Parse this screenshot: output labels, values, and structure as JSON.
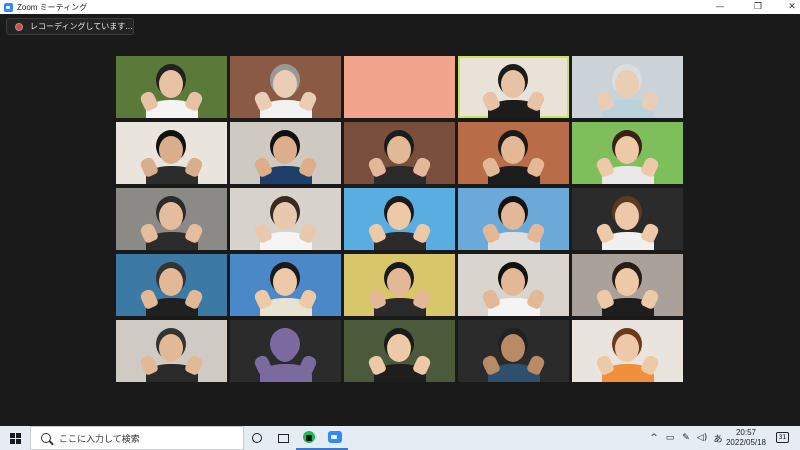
{
  "window": {
    "title": "Zoom ミーティング",
    "minimize": "—",
    "maximize": "❐",
    "close": "✕"
  },
  "recording": {
    "label": "レコーディングしています..."
  },
  "gallery": {
    "active_speaker_index": 3,
    "tiles": [
      {
        "bg": "#5b7a3a",
        "shirt": "#f4f4f4",
        "skin": "#e7c2a4",
        "hair": "#222"
      },
      {
        "bg": "#8a5a44",
        "shirt": "#f2f2f2",
        "skin": "#e9cdb4",
        "hair": "#999"
      },
      {
        "bg": "#f2a48c",
        "shirt": "#f2a48c",
        "skin": "#f2a48c",
        "hair": "#f2a48c"
      },
      {
        "bg": "#e8e2d8",
        "shirt": "#1c1c1c",
        "skin": "#e7c2a4",
        "hair": "#1b1b1b"
      },
      {
        "bg": "#cbd3d8",
        "shirt": "#b9d2dc",
        "skin": "#e9cdb4",
        "hair": "#ddd"
      },
      {
        "bg": "#e9e4dc",
        "shirt": "#2c2c2c",
        "skin": "#d9ae8c",
        "hair": "#111"
      },
      {
        "bg": "#cfcac1",
        "shirt": "#1e3f6a",
        "skin": "#dcae8a",
        "hair": "#111"
      },
      {
        "bg": "#7a4e3c",
        "shirt": "#2a2a2a",
        "skin": "#e2b896",
        "hair": "#1c1c1c"
      },
      {
        "bg": "#b86c48",
        "shirt": "#1d1d1d",
        "skin": "#e2b896",
        "hair": "#1a1a1a"
      },
      {
        "bg": "#7fbf5b",
        "shirt": "#e8e8e8",
        "skin": "#edc9a8",
        "hair": "#3a2210"
      },
      {
        "bg": "#8b8a86",
        "shirt": "#2c2c2c",
        "skin": "#e5bd9d",
        "hair": "#2b2b2b"
      },
      {
        "bg": "#d7d2cb",
        "shirt": "#f5f5f5",
        "skin": "#e9c9ad",
        "hair": "#3a2a1e"
      },
      {
        "bg": "#58aee0",
        "shirt": "#2b2b2b",
        "skin": "#edc9a8",
        "hair": "#1a1a1a"
      },
      {
        "bg": "#6ba9d8",
        "shirt": "#e0e0e0",
        "skin": "#e2b896",
        "hair": "#111"
      },
      {
        "bg": "#2b2b2b",
        "shirt": "#f0f0f0",
        "skin": "#edc9a8",
        "hair": "#5a3a20"
      },
      {
        "bg": "#3c7aa5",
        "shirt": "#202020",
        "skin": "#e2b896",
        "hair": "#333"
      },
      {
        "bg": "#4b88c8",
        "shirt": "#e8e2d2",
        "skin": "#edc9a8",
        "hair": "#1a1a1a"
      },
      {
        "bg": "#d8c66b",
        "shirt": "#2a2a2a",
        "skin": "#e2b896",
        "hair": "#1a1a1a"
      },
      {
        "bg": "#d9d4ce",
        "shirt": "#f4f4f4",
        "skin": "#e2b896",
        "hair": "#111"
      },
      {
        "bg": "#a9a19a",
        "shirt": "#1e1e1e",
        "skin": "#edc9a8",
        "hair": "#2a1c12"
      },
      {
        "bg": "#cfcac4",
        "shirt": "#2a2a2a",
        "skin": "#e2b896",
        "hair": "#333"
      },
      {
        "bg": "#2b2b2b",
        "shirt": "#7a6aa0",
        "skin": "#7a6aa0",
        "hair": "#7a6aa0"
      },
      {
        "bg": "#4a5a3a",
        "shirt": "#1e1e1e",
        "skin": "#edc9a8",
        "hair": "#1a1a1a"
      },
      {
        "bg": "#2b2b2b",
        "shirt": "#2f4f6f",
        "skin": "#b88a66",
        "hair": "#222"
      },
      {
        "bg": "#e9e4dd",
        "shirt": "#f0903a",
        "skin": "#edc9a8",
        "hair": "#6a3a1a"
      }
    ]
  },
  "taskbar": {
    "search_placeholder": "ここに入力して検索",
    "tray_up": "^",
    "tray_ime": "あ",
    "time": "20:57",
    "date": "2022/05/18",
    "notification_count": "31"
  }
}
